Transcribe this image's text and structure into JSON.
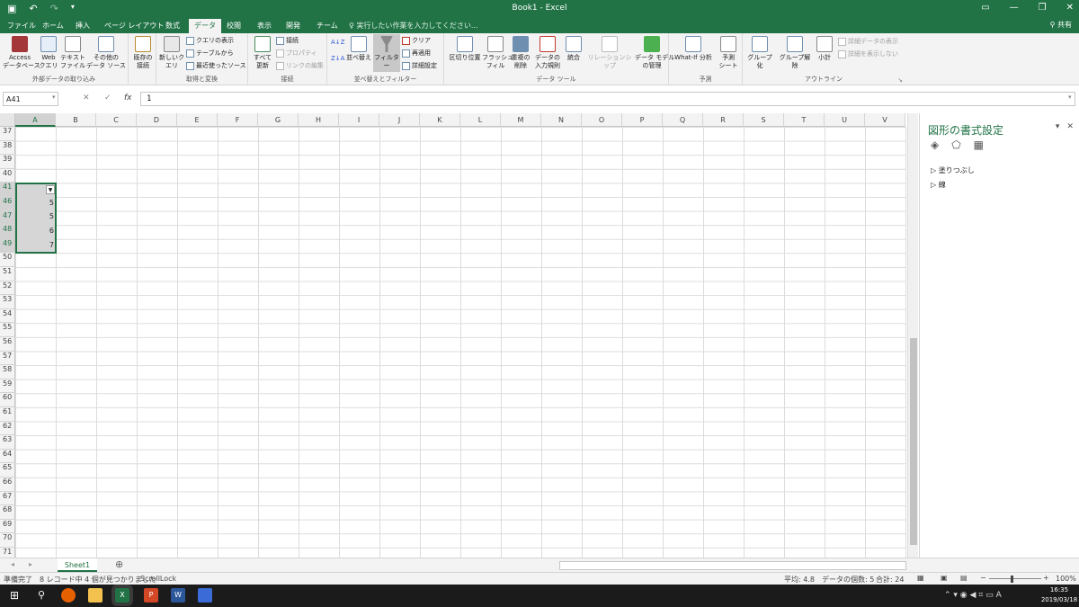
{
  "window": {
    "title": "Book1 - Excel"
  },
  "tabs": [
    "ファイル",
    "ホーム",
    "挿入",
    "ページ レイアウト",
    "数式",
    "データ",
    "校閲",
    "表示",
    "開発",
    "チーム"
  ],
  "tell_me": "実行したい作業を入力してください...",
  "share": "共有",
  "ribbon": {
    "external": {
      "label": "外部データの取り込み",
      "access": "Access\nデータベース",
      "web": "Web\nクエリ",
      "text": "テキスト\nファイル",
      "other": "その他の\nデータ ソース"
    },
    "existing": "既存の\n接続",
    "transform": {
      "label": "取得と変換",
      "new_query": "新しいク\nエリ",
      "show_query": "クエリの表示",
      "from_table": "テーブルから",
      "recent": "最近使ったソース"
    },
    "connections": {
      "label": "接続",
      "refresh_all": "すべて\n更新",
      "connections": "接続",
      "properties": "プロパティ",
      "edit_links": "リンクの編集"
    },
    "sortfilter": {
      "label": "並べ替えとフィルター",
      "sort": "並べ替え",
      "filter": "フィルター",
      "clear": "クリア",
      "reapply": "再適用",
      "advanced": "詳細設定"
    },
    "datatools": {
      "label": "データ ツール",
      "text_to_cols": "区切り位置",
      "flash_fill": "フラッシュ\nフィル",
      "remove_dup": "重複の\n削除",
      "validation": "データの\n入力規則",
      "consolidate": "統合",
      "relationships": "リレーションシップ",
      "data_model": "データ モデル\nの管理"
    },
    "forecast": {
      "label": "予測",
      "whatif": "What-If 分析",
      "forecast_sheet": "予測\nシート"
    },
    "outline": {
      "label": "アウトライン",
      "group": "グループ化",
      "ungroup": "グループ解除",
      "subtotal": "小計",
      "show_detail": "詳細データの表示",
      "hide_detail": "詳細を表示しない"
    }
  },
  "formula_bar": {
    "name_box": "A41",
    "fx": "fx",
    "value": "1"
  },
  "columns": [
    "A",
    "B",
    "C",
    "D",
    "E",
    "F",
    "G",
    "H",
    "I",
    "J",
    "K",
    "L",
    "M",
    "N",
    "O",
    "P",
    "Q",
    "R",
    "S",
    "T",
    "U",
    "V"
  ],
  "rows": [
    "37",
    "38",
    "39",
    "40",
    "41",
    "46",
    "47",
    "48",
    "49",
    "50",
    "51",
    "52",
    "53",
    "54",
    "55",
    "56",
    "57",
    "58",
    "59",
    "60",
    "61",
    "62",
    "63",
    "64",
    "65",
    "66",
    "67",
    "68",
    "69",
    "70",
    "71"
  ],
  "cells": {
    "a46": "5",
    "a47": "5",
    "a48": "6",
    "a49": "7"
  },
  "pane": {
    "title": "図形の書式設定",
    "fill": "塗りつぶし",
    "line": "線"
  },
  "sheet": {
    "tab": "Sheet1"
  },
  "status": {
    "ready": "準備完了",
    "records": "8 レコード中 4 個が見つかりました",
    "scroll_lock": "ScrollLock",
    "average": "平均: 4.8",
    "count": "データの個数: 5",
    "sum": "合計: 24",
    "zoom": "100%"
  },
  "taskbar": {
    "time": "16:35",
    "date": "2019/03/18"
  },
  "colors": {
    "accent": "#217346",
    "filtered_row": "#2b57d6"
  }
}
